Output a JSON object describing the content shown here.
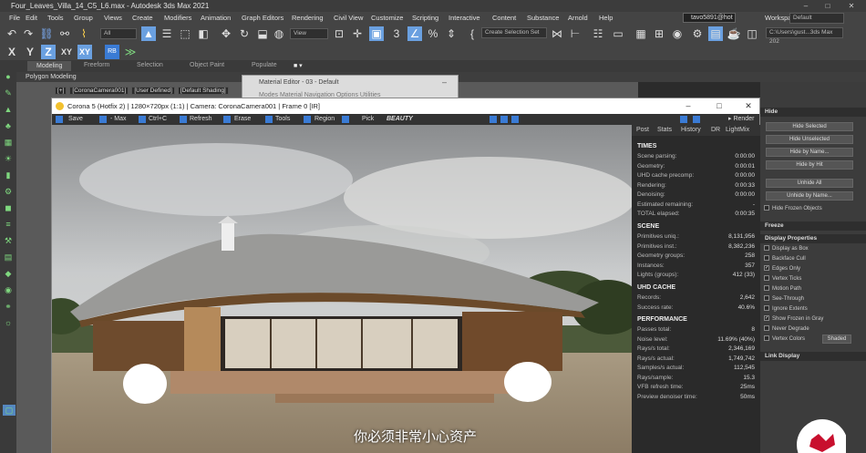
{
  "window": {
    "title": "Four_Leaves_Villa_14_C5_L6.max - Autodesk 3ds Max 2021"
  },
  "menu": [
    "File",
    "Edit",
    "Tools",
    "Group",
    "Views",
    "Create",
    "Modifiers",
    "Animation",
    "Graph Editors",
    "Rendering",
    "Civil View",
    "Customize",
    "Scripting",
    "Interactive",
    "Content",
    "Substance",
    "Arnold",
    "Help"
  ],
  "user": {
    "name": "tavo5891@hot"
  },
  "workspace": {
    "label": "Workspaces:",
    "value": "Default"
  },
  "toolbar": {
    "filter": "All",
    "view": "View",
    "selection_set": "Create Selection Set",
    "path": "C:\\Users\\gust...3ds Max 202",
    "axis_x": "X",
    "axis_y": "Y",
    "axis_z": "Z",
    "axis_xy": "XY",
    "axis_xy2": "XY",
    "rb": "RB"
  },
  "ribbon": {
    "tabs": [
      "Modeling",
      "Freeform",
      "Selection",
      "Object Paint",
      "Populate"
    ],
    "sub": "Polygon Modeling"
  },
  "viewport": {
    "labels": [
      "[+]",
      "[CoronaCamera001]",
      "[User Defined]",
      "[Default Shading]"
    ]
  },
  "material_editor": {
    "title": "Material Editor - 03 - Default",
    "menu": "Modes  Material  Navigation  Options  Utilities"
  },
  "corona": {
    "title": "Corona 5 (Hotfix 2) | 1280×720px (1:1) | Camera: CoronaCamera001 | Frame 0 [IR]",
    "toolbar": [
      "Save",
      "Max",
      "Ctrl+C",
      "Refresh",
      "Erase",
      "Tools",
      "Region",
      "Pick"
    ],
    "channel": "BEAUTY",
    "render_button": "Render",
    "tabs": [
      "Post",
      "Stats",
      "History",
      "DR",
      "LightMix"
    ],
    "times_header": "TIMES",
    "times": [
      [
        "Scene parsing:",
        "0:00:00"
      ],
      [
        "Geometry:",
        "0:00:01"
      ],
      [
        "UHD cache precomp:",
        "0:00:00"
      ],
      [
        "Rendering:",
        "0:00:33"
      ],
      [
        "Denoising:",
        "0:00:00"
      ],
      [
        "Estimated remaining:",
        "-"
      ],
      [
        "TOTAL elapsed:",
        "0:00:35"
      ]
    ],
    "scene_header": "SCENE",
    "scene": [
      [
        "Primitives uniq.:",
        "8,131,956"
      ],
      [
        "Primitives inst.:",
        "8,382,236"
      ],
      [
        "Geometry groups:",
        "258"
      ],
      [
        "Instances:",
        "357"
      ],
      [
        "Lights (groups):",
        "412 (33)"
      ]
    ],
    "uhd_header": "UHD CACHE",
    "uhd": [
      [
        "Records:",
        "2,642"
      ],
      [
        "Success rate:",
        "40.6%"
      ]
    ],
    "perf_header": "PERFORMANCE",
    "perf": [
      [
        "Passes total:",
        "8"
      ],
      [
        "Noise level:",
        "11.69% (40%)"
      ],
      [
        "Rays/s total:",
        "2,346,169"
      ],
      [
        "Rays/s actual:",
        "1,749,742"
      ],
      [
        "Samples/s actual:",
        "112,545"
      ],
      [
        "Rays/sample:",
        "15.3"
      ],
      [
        "VFB refresh time:",
        "25ms"
      ],
      [
        "Preview denoiser time:",
        "50ms"
      ]
    ]
  },
  "right_panel": {
    "hide_header": "Hide",
    "hide_buttons": [
      "Hide Selected",
      "Hide Unselected",
      "Hide by Name...",
      "Hide by Hit",
      "Unhide All",
      "Unhide by Name..."
    ],
    "hide_frozen": "Hide Frozen Objects",
    "freeze_header": "Freeze",
    "display_header": "Display Properties",
    "display_items": [
      {
        "label": "Display as Box",
        "checked": false
      },
      {
        "label": "Backface Cull",
        "checked": false
      },
      {
        "label": "Edges Only",
        "checked": true
      },
      {
        "label": "Vertex Ticks",
        "checked": false
      },
      {
        "label": "Motion Path",
        "checked": false
      },
      {
        "label": "See-Through",
        "checked": false
      },
      {
        "label": "Ignore Extents",
        "checked": false
      },
      {
        "label": "Show Frozen in Gray",
        "checked": true
      },
      {
        "label": "Never Degrade",
        "checked": false
      },
      {
        "label": "Vertex Colors",
        "checked": false
      }
    ],
    "shaded": "Shaded",
    "link_header": "Link Display"
  },
  "subtitle": "你必须非常小心资产"
}
